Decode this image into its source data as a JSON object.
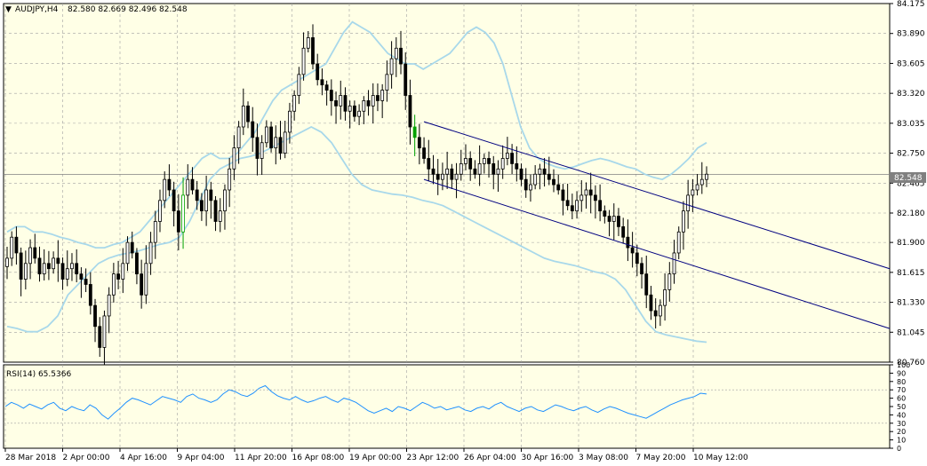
{
  "window": {
    "title": "AUDJPY,H4",
    "ohlc": "82.580 82.669 82.496 82.548",
    "rsi_title": "RSI(14) 65.5366"
  },
  "colors": {
    "background": "#ffffe6",
    "grid": "#a0a0a0",
    "candle": "#000000",
    "bollinger": "#a8d8ea",
    "channel": "#000080",
    "rsi_line": "#1e90ff",
    "price_line": "#808080",
    "green_candle": "#00a000"
  },
  "chart_data": [
    {
      "type": "candlestick",
      "title": "AUDJPY,H4",
      "x_labels": [
        "28 Mar 2018",
        "2 Apr 00:00",
        "4 Apr 16:00",
        "9 Apr 04:00",
        "11 Apr 20:00",
        "16 Apr 08:00",
        "19 Apr 00:00",
        "23 Apr 12:00",
        "26 Apr 04:00",
        "30 Apr 16:00",
        "3 May 08:00",
        "7 May 20:00",
        "10 May 12:00"
      ],
      "y_ticks": [
        "84.175",
        "83.890",
        "83.605",
        "83.320",
        "83.035",
        "82.750",
        "82.465",
        "82.180",
        "81.900",
        "81.615",
        "81.330",
        "81.045",
        "80.760"
      ],
      "ylim": [
        80.76,
        84.175
      ],
      "current_price_label": "82.548",
      "current_price": 82.548,
      "series": [
        {
          "label": "price",
          "close": [
            81.75,
            81.95,
            81.8,
            81.55,
            81.7,
            81.85,
            81.75,
            81.6,
            81.7,
            81.65,
            81.75,
            81.7,
            81.55,
            81.65,
            81.7,
            81.6,
            81.55,
            81.5,
            81.3,
            81.1,
            80.9,
            81.2,
            81.4,
            81.6,
            81.55,
            81.7,
            81.9,
            81.8,
            81.6,
            81.4,
            81.7,
            81.9,
            82.1,
            82.3,
            82.5,
            82.4,
            82.2,
            82.0,
            82.35,
            82.5,
            82.4,
            82.3,
            82.2,
            82.4,
            82.3,
            82.1,
            82.2,
            82.4,
            82.6,
            82.8,
            83.0,
            83.2,
            83.05,
            82.9,
            82.7,
            82.85,
            83.0,
            82.8,
            82.9,
            82.75,
            82.95,
            83.15,
            83.3,
            83.5,
            83.75,
            83.85,
            83.6,
            83.45,
            83.4,
            83.35,
            83.25,
            83.2,
            83.3,
            83.15,
            83.2,
            83.1,
            83.15,
            83.25,
            83.2,
            83.3,
            83.25,
            83.35,
            83.5,
            83.65,
            83.75,
            83.6,
            83.3,
            83.0,
            82.9,
            82.8,
            82.7,
            82.6,
            82.55,
            82.5,
            82.55,
            82.6,
            82.5,
            82.55,
            82.65,
            82.7,
            82.6,
            82.55,
            82.65,
            82.7,
            82.65,
            82.55,
            82.6,
            82.7,
            82.75,
            82.65,
            82.6,
            82.5,
            82.4,
            82.45,
            82.55,
            82.6,
            82.55,
            82.5,
            82.45,
            82.4,
            82.3,
            82.25,
            82.2,
            82.3,
            82.35,
            82.4,
            82.35,
            82.3,
            82.2,
            82.15,
            82.1,
            82.15,
            82.05,
            81.95,
            81.85,
            81.8,
            81.7,
            81.6,
            81.4,
            81.25,
            81.2,
            81.3,
            81.45,
            81.6,
            81.8,
            82.0,
            82.2,
            82.35,
            82.4,
            82.45,
            82.5,
            82.55
          ]
        }
      ],
      "bollinger": {
        "upper": [
          82.0,
          82.05,
          82.05,
          82.0,
          82.0,
          81.98,
          81.95,
          81.93,
          81.9,
          81.88,
          81.85,
          81.85,
          81.88,
          81.9,
          81.95,
          82.0,
          82.1,
          82.2,
          82.3,
          82.4,
          82.5,
          82.6,
          82.7,
          82.75,
          82.7,
          82.7,
          82.75,
          82.85,
          82.95,
          83.1,
          83.25,
          83.35,
          83.4,
          83.45,
          83.5,
          83.55,
          83.6,
          83.75,
          83.9,
          84.0,
          83.95,
          83.9,
          83.8,
          83.7,
          83.65,
          83.6,
          83.6,
          83.55,
          83.6,
          83.65,
          83.7,
          83.8,
          83.9,
          83.95,
          83.9,
          83.8,
          83.6,
          83.3,
          83.0,
          82.8,
          82.7,
          82.65,
          82.62,
          82.6,
          82.62,
          82.65,
          82.68,
          82.7,
          82.68,
          82.65,
          82.62,
          82.6,
          82.55,
          82.52,
          82.5,
          82.55,
          82.62,
          82.7,
          82.8,
          82.85
        ],
        "lower": [
          81.1,
          81.08,
          81.05,
          81.05,
          81.1,
          81.2,
          81.4,
          81.5,
          81.6,
          81.7,
          81.75,
          81.78,
          81.8,
          81.82,
          81.85,
          81.88,
          81.9,
          81.95,
          82.1,
          82.3,
          82.5,
          82.6,
          82.65,
          82.7,
          82.72,
          82.75,
          82.8,
          82.85,
          82.9,
          82.95,
          83.0,
          82.95,
          82.85,
          82.7,
          82.55,
          82.45,
          82.4,
          82.38,
          82.36,
          82.35,
          82.33,
          82.3,
          82.28,
          82.25,
          82.2,
          82.15,
          82.1,
          82.05,
          82.0,
          81.95,
          81.9,
          81.85,
          81.8,
          81.75,
          81.72,
          81.7,
          81.68,
          81.65,
          81.62,
          81.6,
          81.55,
          81.45,
          81.3,
          81.15,
          81.05,
          81.02,
          81.0,
          80.98,
          80.96,
          80.95
        ]
      },
      "channel": [
        {
          "x1_label": "23 Apr 12:00",
          "y1": 83.05,
          "y2": 81.65
        },
        {
          "x1_label": "23 Apr 12:00",
          "y1": 82.5,
          "y2": 81.08
        }
      ]
    },
    {
      "type": "line",
      "title": "RSI(14) 65.5366",
      "y_ticks": [
        "100",
        "90",
        "80",
        "70",
        "60",
        "50",
        "40",
        "30",
        "20",
        "10",
        "0"
      ],
      "ylim": [
        0,
        100
      ],
      "series": [
        {
          "label": "RSI(14)",
          "values": [
            50,
            55,
            52,
            48,
            53,
            50,
            47,
            52,
            55,
            48,
            45,
            50,
            47,
            45,
            52,
            48,
            40,
            35,
            42,
            48,
            55,
            60,
            58,
            55,
            52,
            57,
            62,
            60,
            58,
            55,
            62,
            65,
            60,
            58,
            55,
            58,
            65,
            70,
            68,
            64,
            62,
            66,
            72,
            75,
            68,
            63,
            60,
            58,
            62,
            58,
            55,
            57,
            60,
            62,
            58,
            55,
            60,
            58,
            55,
            50,
            45,
            42,
            45,
            48,
            44,
            50,
            48,
            45,
            50,
            55,
            52,
            48,
            50,
            46,
            48,
            50,
            46,
            44,
            48,
            50,
            47,
            52,
            55,
            50,
            47,
            44,
            48,
            50,
            46,
            44,
            48,
            52,
            50,
            47,
            45,
            48,
            50,
            46,
            43,
            47,
            50,
            48,
            45,
            42,
            40,
            38,
            36,
            40,
            44,
            48,
            52,
            55,
            58,
            60,
            62,
            66,
            65
          ]
        }
      ]
    }
  ]
}
